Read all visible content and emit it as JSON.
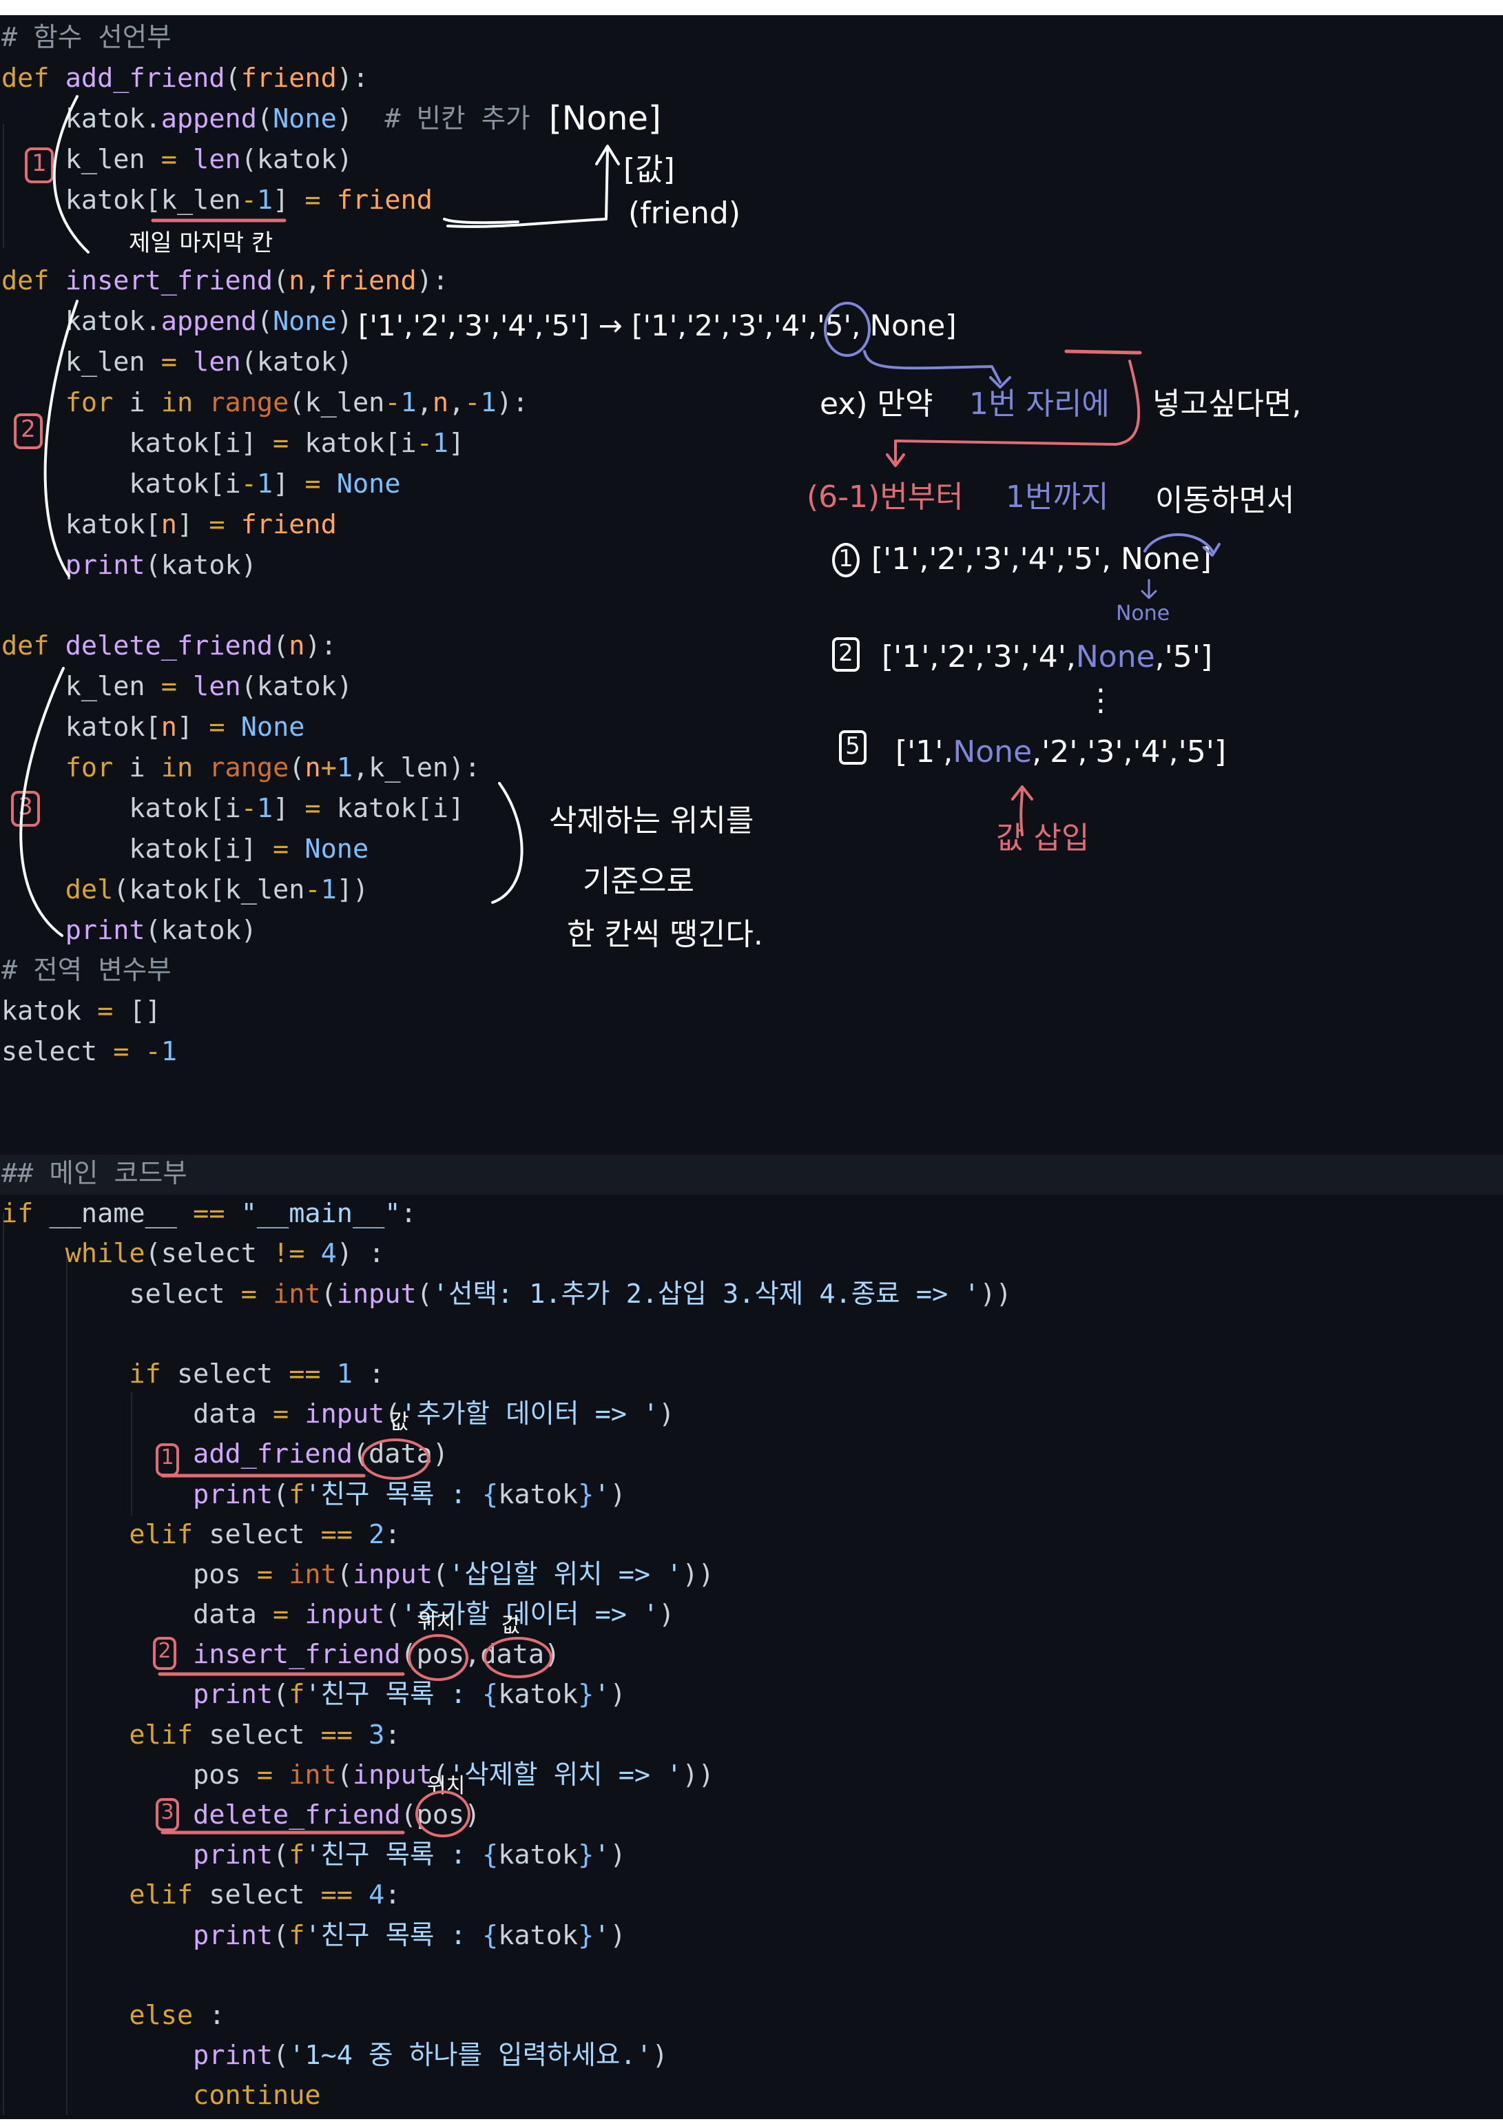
{
  "colors": {
    "background": "#0d1117",
    "plain": "#c9d1d9",
    "keyword": "#d9a52b",
    "operator": "#d9a52b",
    "function": "#d2a8ff",
    "param": "#ffa657",
    "constant": "#79c0ff",
    "string": "#a5d6ff",
    "comment": "#8b949e",
    "builtin": "#d0712c",
    "annotation_white": "#ffffff",
    "annotation_red": "#e06c75",
    "annotation_purple": "#7f86d8"
  },
  "code": {
    "top": [
      [
        [
          "m",
          "# 함수 선언부"
        ]
      ],
      [
        [
          "k",
          "def"
        ],
        [
          "t",
          " "
        ],
        [
          "f",
          "add_friend"
        ],
        [
          "t",
          "("
        ],
        [
          "p",
          "friend"
        ],
        [
          "t",
          "):"
        ]
      ],
      [
        [
          "t",
          "    katok."
        ],
        [
          "f",
          "append"
        ],
        [
          "t",
          "("
        ],
        [
          "c",
          "None"
        ],
        [
          "t",
          ")  "
        ],
        [
          "m",
          "# 빈칸 추가"
        ]
      ],
      [
        [
          "t",
          "    k_len "
        ],
        [
          "o",
          "="
        ],
        [
          "t",
          " "
        ],
        [
          "f",
          "len"
        ],
        [
          "t",
          "(katok)"
        ]
      ],
      [
        [
          "t",
          "    katok[k_len"
        ],
        [
          "o",
          "-"
        ],
        [
          "c",
          "1"
        ],
        [
          "t",
          "] "
        ],
        [
          "o",
          "="
        ],
        [
          "t",
          " "
        ],
        [
          "p",
          "friend"
        ]
      ],
      [],
      [
        [
          "k",
          "def"
        ],
        [
          "t",
          " "
        ],
        [
          "f",
          "insert_friend"
        ],
        [
          "t",
          "("
        ],
        [
          "p",
          "n"
        ],
        [
          "t",
          ","
        ],
        [
          "p",
          "friend"
        ],
        [
          "t",
          "):"
        ]
      ],
      [
        [
          "t",
          "    katok."
        ],
        [
          "f",
          "append"
        ],
        [
          "t",
          "("
        ],
        [
          "c",
          "None"
        ],
        [
          "t",
          ")"
        ]
      ],
      [
        [
          "t",
          "    k_len "
        ],
        [
          "o",
          "="
        ],
        [
          "t",
          " "
        ],
        [
          "f",
          "len"
        ],
        [
          "t",
          "(katok)"
        ]
      ],
      [
        [
          "k",
          "    for"
        ],
        [
          "t",
          " i "
        ],
        [
          "k",
          "in"
        ],
        [
          "t",
          " "
        ],
        [
          "b",
          "range"
        ],
        [
          "t",
          "(k_len"
        ],
        [
          "o",
          "-"
        ],
        [
          "c",
          "1"
        ],
        [
          "t",
          ","
        ],
        [
          "p",
          "n"
        ],
        [
          "t",
          ","
        ],
        [
          "o",
          "-"
        ],
        [
          "c",
          "1"
        ],
        [
          "t",
          "):"
        ]
      ],
      [
        [
          "t",
          "        katok[i] "
        ],
        [
          "o",
          "="
        ],
        [
          "t",
          " katok[i"
        ],
        [
          "o",
          "-"
        ],
        [
          "c",
          "1"
        ],
        [
          "t",
          "]"
        ]
      ],
      [
        [
          "t",
          "        katok[i"
        ],
        [
          "o",
          "-"
        ],
        [
          "c",
          "1"
        ],
        [
          "t",
          "] "
        ],
        [
          "o",
          "="
        ],
        [
          "t",
          " "
        ],
        [
          "c",
          "None"
        ]
      ],
      [
        [
          "t",
          "    katok["
        ],
        [
          "p",
          "n"
        ],
        [
          "t",
          "] "
        ],
        [
          "o",
          "="
        ],
        [
          "t",
          " "
        ],
        [
          "p",
          "friend"
        ]
      ],
      [
        [
          "t",
          "    "
        ],
        [
          "f",
          "print"
        ],
        [
          "t",
          "(katok)"
        ]
      ],
      [],
      [
        [
          "k",
          "def"
        ],
        [
          "t",
          " "
        ],
        [
          "f",
          "delete_friend"
        ],
        [
          "t",
          "("
        ],
        [
          "p",
          "n"
        ],
        [
          "t",
          "):"
        ]
      ],
      [
        [
          "t",
          "    k_len "
        ],
        [
          "o",
          "="
        ],
        [
          "t",
          " "
        ],
        [
          "f",
          "len"
        ],
        [
          "t",
          "(katok)"
        ]
      ],
      [
        [
          "t",
          "    katok["
        ],
        [
          "p",
          "n"
        ],
        [
          "t",
          "] "
        ],
        [
          "o",
          "="
        ],
        [
          "t",
          " "
        ],
        [
          "c",
          "None"
        ]
      ],
      [
        [
          "k",
          "    for"
        ],
        [
          "t",
          " i "
        ],
        [
          "k",
          "in"
        ],
        [
          "t",
          " "
        ],
        [
          "b",
          "range"
        ],
        [
          "t",
          "("
        ],
        [
          "p",
          "n"
        ],
        [
          "o",
          "+"
        ],
        [
          "c",
          "1"
        ],
        [
          "t",
          ",k_len):"
        ]
      ],
      [
        [
          "t",
          "        katok[i"
        ],
        [
          "o",
          "-"
        ],
        [
          "c",
          "1"
        ],
        [
          "t",
          "] "
        ],
        [
          "o",
          "="
        ],
        [
          "t",
          " katok[i]"
        ]
      ],
      [
        [
          "t",
          "        katok[i] "
        ],
        [
          "o",
          "="
        ],
        [
          "t",
          " "
        ],
        [
          "c",
          "None"
        ]
      ],
      [
        [
          "k",
          "    del"
        ],
        [
          "t",
          "(katok[k_len"
        ],
        [
          "o",
          "-"
        ],
        [
          "c",
          "1"
        ],
        [
          "t",
          "])"
        ]
      ],
      [
        [
          "t",
          "    "
        ],
        [
          "f",
          "print"
        ],
        [
          "t",
          "(katok)"
        ]
      ],
      [
        [
          "m",
          "# 전역 변수부"
        ]
      ],
      [
        [
          "t",
          "katok "
        ],
        [
          "o",
          "="
        ],
        [
          "t",
          " []"
        ]
      ],
      [
        [
          "t",
          "select "
        ],
        [
          "o",
          "="
        ],
        [
          "t",
          " "
        ],
        [
          "o",
          "-"
        ],
        [
          "c",
          "1"
        ]
      ]
    ],
    "main": [
      [
        [
          "m",
          "## 메인 코드부"
        ]
      ],
      [
        [
          "k",
          "if"
        ],
        [
          "t",
          " __name__ "
        ],
        [
          "o",
          "=="
        ],
        [
          "t",
          " "
        ],
        [
          "s",
          "\"__main__\""
        ],
        [
          "t",
          ":"
        ]
      ],
      [
        [
          "k",
          "    while"
        ],
        [
          "t",
          "(select "
        ],
        [
          "o",
          "!="
        ],
        [
          "t",
          " "
        ],
        [
          "c",
          "4"
        ],
        [
          "t",
          ") :"
        ]
      ],
      [
        [
          "t",
          "        select "
        ],
        [
          "o",
          "="
        ],
        [
          "t",
          " "
        ],
        [
          "b",
          "int"
        ],
        [
          "t",
          "("
        ],
        [
          "f",
          "input"
        ],
        [
          "t",
          "("
        ],
        [
          "s",
          "'선택: 1.추가 2.삽입 3.삭제 4.종료 => '"
        ],
        [
          "t",
          "))"
        ]
      ],
      [],
      [
        [
          "k",
          "        if"
        ],
        [
          "t",
          " select "
        ],
        [
          "o",
          "=="
        ],
        [
          "t",
          " "
        ],
        [
          "c",
          "1"
        ],
        [
          "t",
          " :"
        ]
      ],
      [
        [
          "t",
          "            data "
        ],
        [
          "o",
          "="
        ],
        [
          "t",
          " "
        ],
        [
          "f",
          "input"
        ],
        [
          "t",
          "("
        ],
        [
          "s",
          "'추가할 데이터 => '"
        ],
        [
          "t",
          ")"
        ]
      ],
      [
        [
          "t",
          "            "
        ],
        [
          "f",
          "add_friend"
        ],
        [
          "t",
          "(data)"
        ]
      ],
      [
        [
          "t",
          "            "
        ],
        [
          "f",
          "print"
        ],
        [
          "t",
          "("
        ],
        [
          "k",
          "f"
        ],
        [
          "s",
          "'친구 목록 : "
        ],
        [
          "c",
          "{"
        ],
        [
          "t",
          "katok"
        ],
        [
          "c",
          "}"
        ],
        [
          "s",
          "'"
        ],
        [
          "t",
          ")"
        ]
      ],
      [
        [
          "k",
          "        elif"
        ],
        [
          "t",
          " select "
        ],
        [
          "o",
          "=="
        ],
        [
          "t",
          " "
        ],
        [
          "c",
          "2"
        ],
        [
          "t",
          ":"
        ]
      ],
      [
        [
          "t",
          "            pos "
        ],
        [
          "o",
          "="
        ],
        [
          "t",
          " "
        ],
        [
          "b",
          "int"
        ],
        [
          "t",
          "("
        ],
        [
          "f",
          "input"
        ],
        [
          "t",
          "("
        ],
        [
          "s",
          "'삽입할 위치 => '"
        ],
        [
          "t",
          "))"
        ]
      ],
      [
        [
          "t",
          "            data "
        ],
        [
          "o",
          "="
        ],
        [
          "t",
          " "
        ],
        [
          "f",
          "input"
        ],
        [
          "t",
          "("
        ],
        [
          "s",
          "'추가할 데이터 => '"
        ],
        [
          "t",
          ")"
        ]
      ],
      [
        [
          "t",
          "            "
        ],
        [
          "f",
          "insert_friend"
        ],
        [
          "t",
          "(pos,data)"
        ]
      ],
      [
        [
          "t",
          "            "
        ],
        [
          "f",
          "print"
        ],
        [
          "t",
          "("
        ],
        [
          "k",
          "f"
        ],
        [
          "s",
          "'친구 목록 : "
        ],
        [
          "c",
          "{"
        ],
        [
          "t",
          "katok"
        ],
        [
          "c",
          "}"
        ],
        [
          "s",
          "'"
        ],
        [
          "t",
          ")"
        ]
      ],
      [
        [
          "k",
          "        elif"
        ],
        [
          "t",
          " select "
        ],
        [
          "o",
          "=="
        ],
        [
          "t",
          " "
        ],
        [
          "c",
          "3"
        ],
        [
          "t",
          ":"
        ]
      ],
      [
        [
          "t",
          "            pos "
        ],
        [
          "o",
          "="
        ],
        [
          "t",
          " "
        ],
        [
          "b",
          "int"
        ],
        [
          "t",
          "("
        ],
        [
          "f",
          "input"
        ],
        [
          "t",
          "("
        ],
        [
          "s",
          "'삭제할 위치 => '"
        ],
        [
          "t",
          "))"
        ]
      ],
      [
        [
          "t",
          "            "
        ],
        [
          "f",
          "delete_friend"
        ],
        [
          "t",
          "(pos)"
        ]
      ],
      [
        [
          "t",
          "            "
        ],
        [
          "f",
          "print"
        ],
        [
          "t",
          "("
        ],
        [
          "k",
          "f"
        ],
        [
          "s",
          "'친구 목록 : "
        ],
        [
          "c",
          "{"
        ],
        [
          "t",
          "katok"
        ],
        [
          "c",
          "}"
        ],
        [
          "s",
          "'"
        ],
        [
          "t",
          ")"
        ]
      ],
      [
        [
          "k",
          "        elif"
        ],
        [
          "t",
          " select "
        ],
        [
          "o",
          "=="
        ],
        [
          "t",
          " "
        ],
        [
          "c",
          "4"
        ],
        [
          "t",
          ":"
        ]
      ],
      [
        [
          "t",
          "            "
        ],
        [
          "f",
          "print"
        ],
        [
          "t",
          "("
        ],
        [
          "k",
          "f"
        ],
        [
          "s",
          "'친구 목록 : "
        ],
        [
          "c",
          "{"
        ],
        [
          "t",
          "katok"
        ],
        [
          "c",
          "}"
        ],
        [
          "s",
          "'"
        ],
        [
          "t",
          ")"
        ]
      ],
      [],
      [
        [
          "k",
          "        else"
        ],
        [
          "t",
          " :"
        ]
      ],
      [
        [
          "t",
          "            "
        ],
        [
          "f",
          "print"
        ],
        [
          "t",
          "("
        ],
        [
          "s",
          "'1~4 중 하나를 입력하세요.'"
        ],
        [
          "t",
          ")"
        ]
      ],
      [
        [
          "k",
          "            continue"
        ]
      ]
    ]
  },
  "annotations": {
    "add": {
      "marker": "1",
      "none_list": "[None]",
      "value_list": "[값]",
      "friend_label": "(friend)",
      "last_cell": "제일 마지막 칸"
    },
    "insert": {
      "marker": "2",
      "transform": "['1','2','3','4','5'] → ['1','2','3','4','5', None]",
      "ex_prefix": "ex) 만약",
      "ex_position": "1번 자리에",
      "ex_suffix": "넣고싶다면,",
      "range_from": "(6-1)번부터",
      "range_to": "1번까지",
      "range_suffix": "이동하면서",
      "step1_marker": "1",
      "step1": "['1','2','3','4','5', None]",
      "step1_none": "None",
      "step2_marker": "2",
      "step2_a": "['1','2','3','4',",
      "step2_none": "None",
      "step2_b": ",'5']",
      "ellipsis": "⋮",
      "step5_marker": "5",
      "step5_a": "['1',",
      "step5_none": "None",
      "step5_b": ",'2','3','4','5']",
      "insert_value": "값 삽입"
    },
    "delete": {
      "marker": "3",
      "line1": "삭제하는 위치를",
      "line2": "기준으로",
      "line3": "한 칸씩 땡긴다."
    },
    "main": {
      "marker1": "1",
      "value1": "값",
      "marker2": "2",
      "position2": "위치",
      "value2": "값",
      "marker3": "3",
      "position3": "위치"
    }
  }
}
